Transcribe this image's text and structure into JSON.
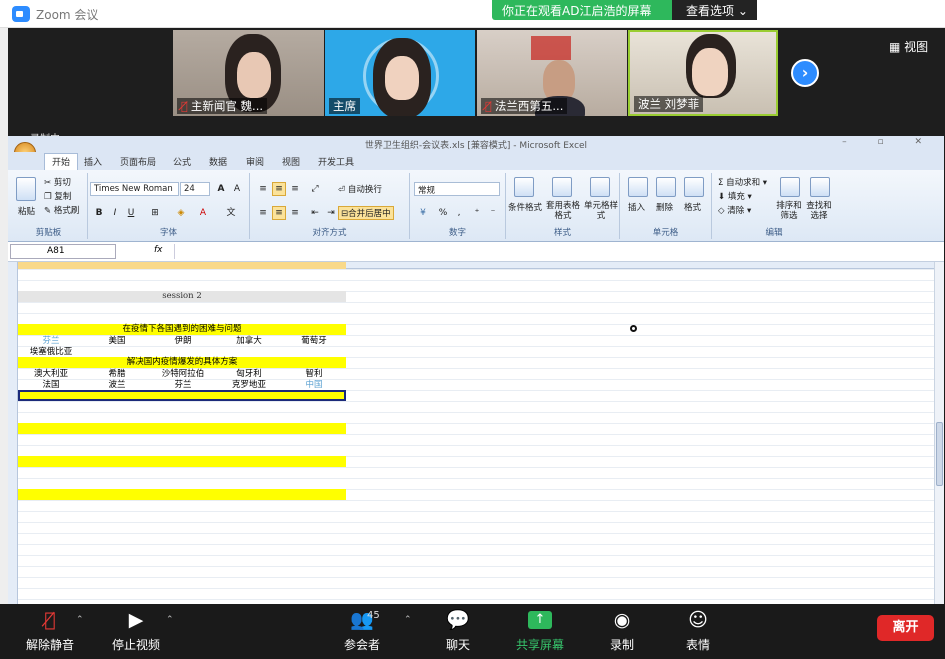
{
  "app": {
    "title": "Zoom 会议",
    "share_notice": "你正在观看AD江启浩的屏幕",
    "view_options": "查看选项 ⌄",
    "view_button": "▦ 视图",
    "next_icon": "chevron-right-icon",
    "recording_label": "录制中"
  },
  "participants": [
    {
      "name": "主新闻官 魏...",
      "muted": true
    },
    {
      "name": "主席",
      "muted": false
    },
    {
      "name": "法兰西第五...",
      "muted": true
    },
    {
      "name": "波兰 刘梦菲",
      "muted": false
    }
  ],
  "excel": {
    "window_title": "世界卫生组织-会议表.xls [兼容模式] - Microsoft Excel",
    "window_controls": "– ▫ ✕",
    "tabs": [
      "开始",
      "插入",
      "页面布局",
      "公式",
      "数据",
      "审阅",
      "视图",
      "开发工具"
    ],
    "clipboard": {
      "paste": "粘贴",
      "cut": "剪切",
      "copy": "复制",
      "format_painter": "格式刷",
      "label": "剪贴板"
    },
    "font": {
      "name": "Times New Roman",
      "size": "24",
      "label": "字体"
    },
    "alignment": {
      "wrap": "自动换行",
      "merge": "合并后居中",
      "label": "对齐方式"
    },
    "number": {
      "format": "常规",
      "label": "数字"
    },
    "styles": {
      "conditional": "条件格式",
      "table": "套用表格格式",
      "cell": "单元格样式",
      "label": "样式"
    },
    "cells": {
      "insert": "插入",
      "delete": "删除",
      "format": "格式",
      "label": "单元格"
    },
    "editing": {
      "autosum": "Σ 自动求和 ▾",
      "fill": "填充 ▾",
      "clear": "清除 ▾",
      "sort": "排序和筛选",
      "find": "查找和选择",
      "label": "编辑"
    },
    "name_box": "A81",
    "fx": "fx",
    "sheet": {
      "session": "session 2",
      "topic1": "在疫情下各国遇到的困难与问题",
      "row1": [
        "芬兰",
        "美国",
        "伊朗",
        "加拿大",
        "葡萄牙"
      ],
      "row2": [
        "埃塞俄比亚"
      ],
      "topic2": "解决国内疫情爆发的具体方案",
      "row3": [
        "澳大利亚",
        "希腊",
        "沙特阿拉伯",
        "匈牙利",
        "智利"
      ],
      "row4": [
        "法国",
        "波兰",
        "芬兰",
        "克罗地亚",
        "中国"
      ]
    }
  },
  "colors": {
    "highlight": "#ffff00",
    "zoom_blue": "#2d8cff",
    "share_green": "#2eb85c",
    "leave_red": "#e02828"
  },
  "toolbar": {
    "unmute": "解除静音",
    "stop_video": "停止视频",
    "participants": "参会者",
    "participant_count": "45",
    "chat": "聊天",
    "share": "共享屏幕",
    "record": "录制",
    "reactions": "表情",
    "leave": "离开"
  }
}
